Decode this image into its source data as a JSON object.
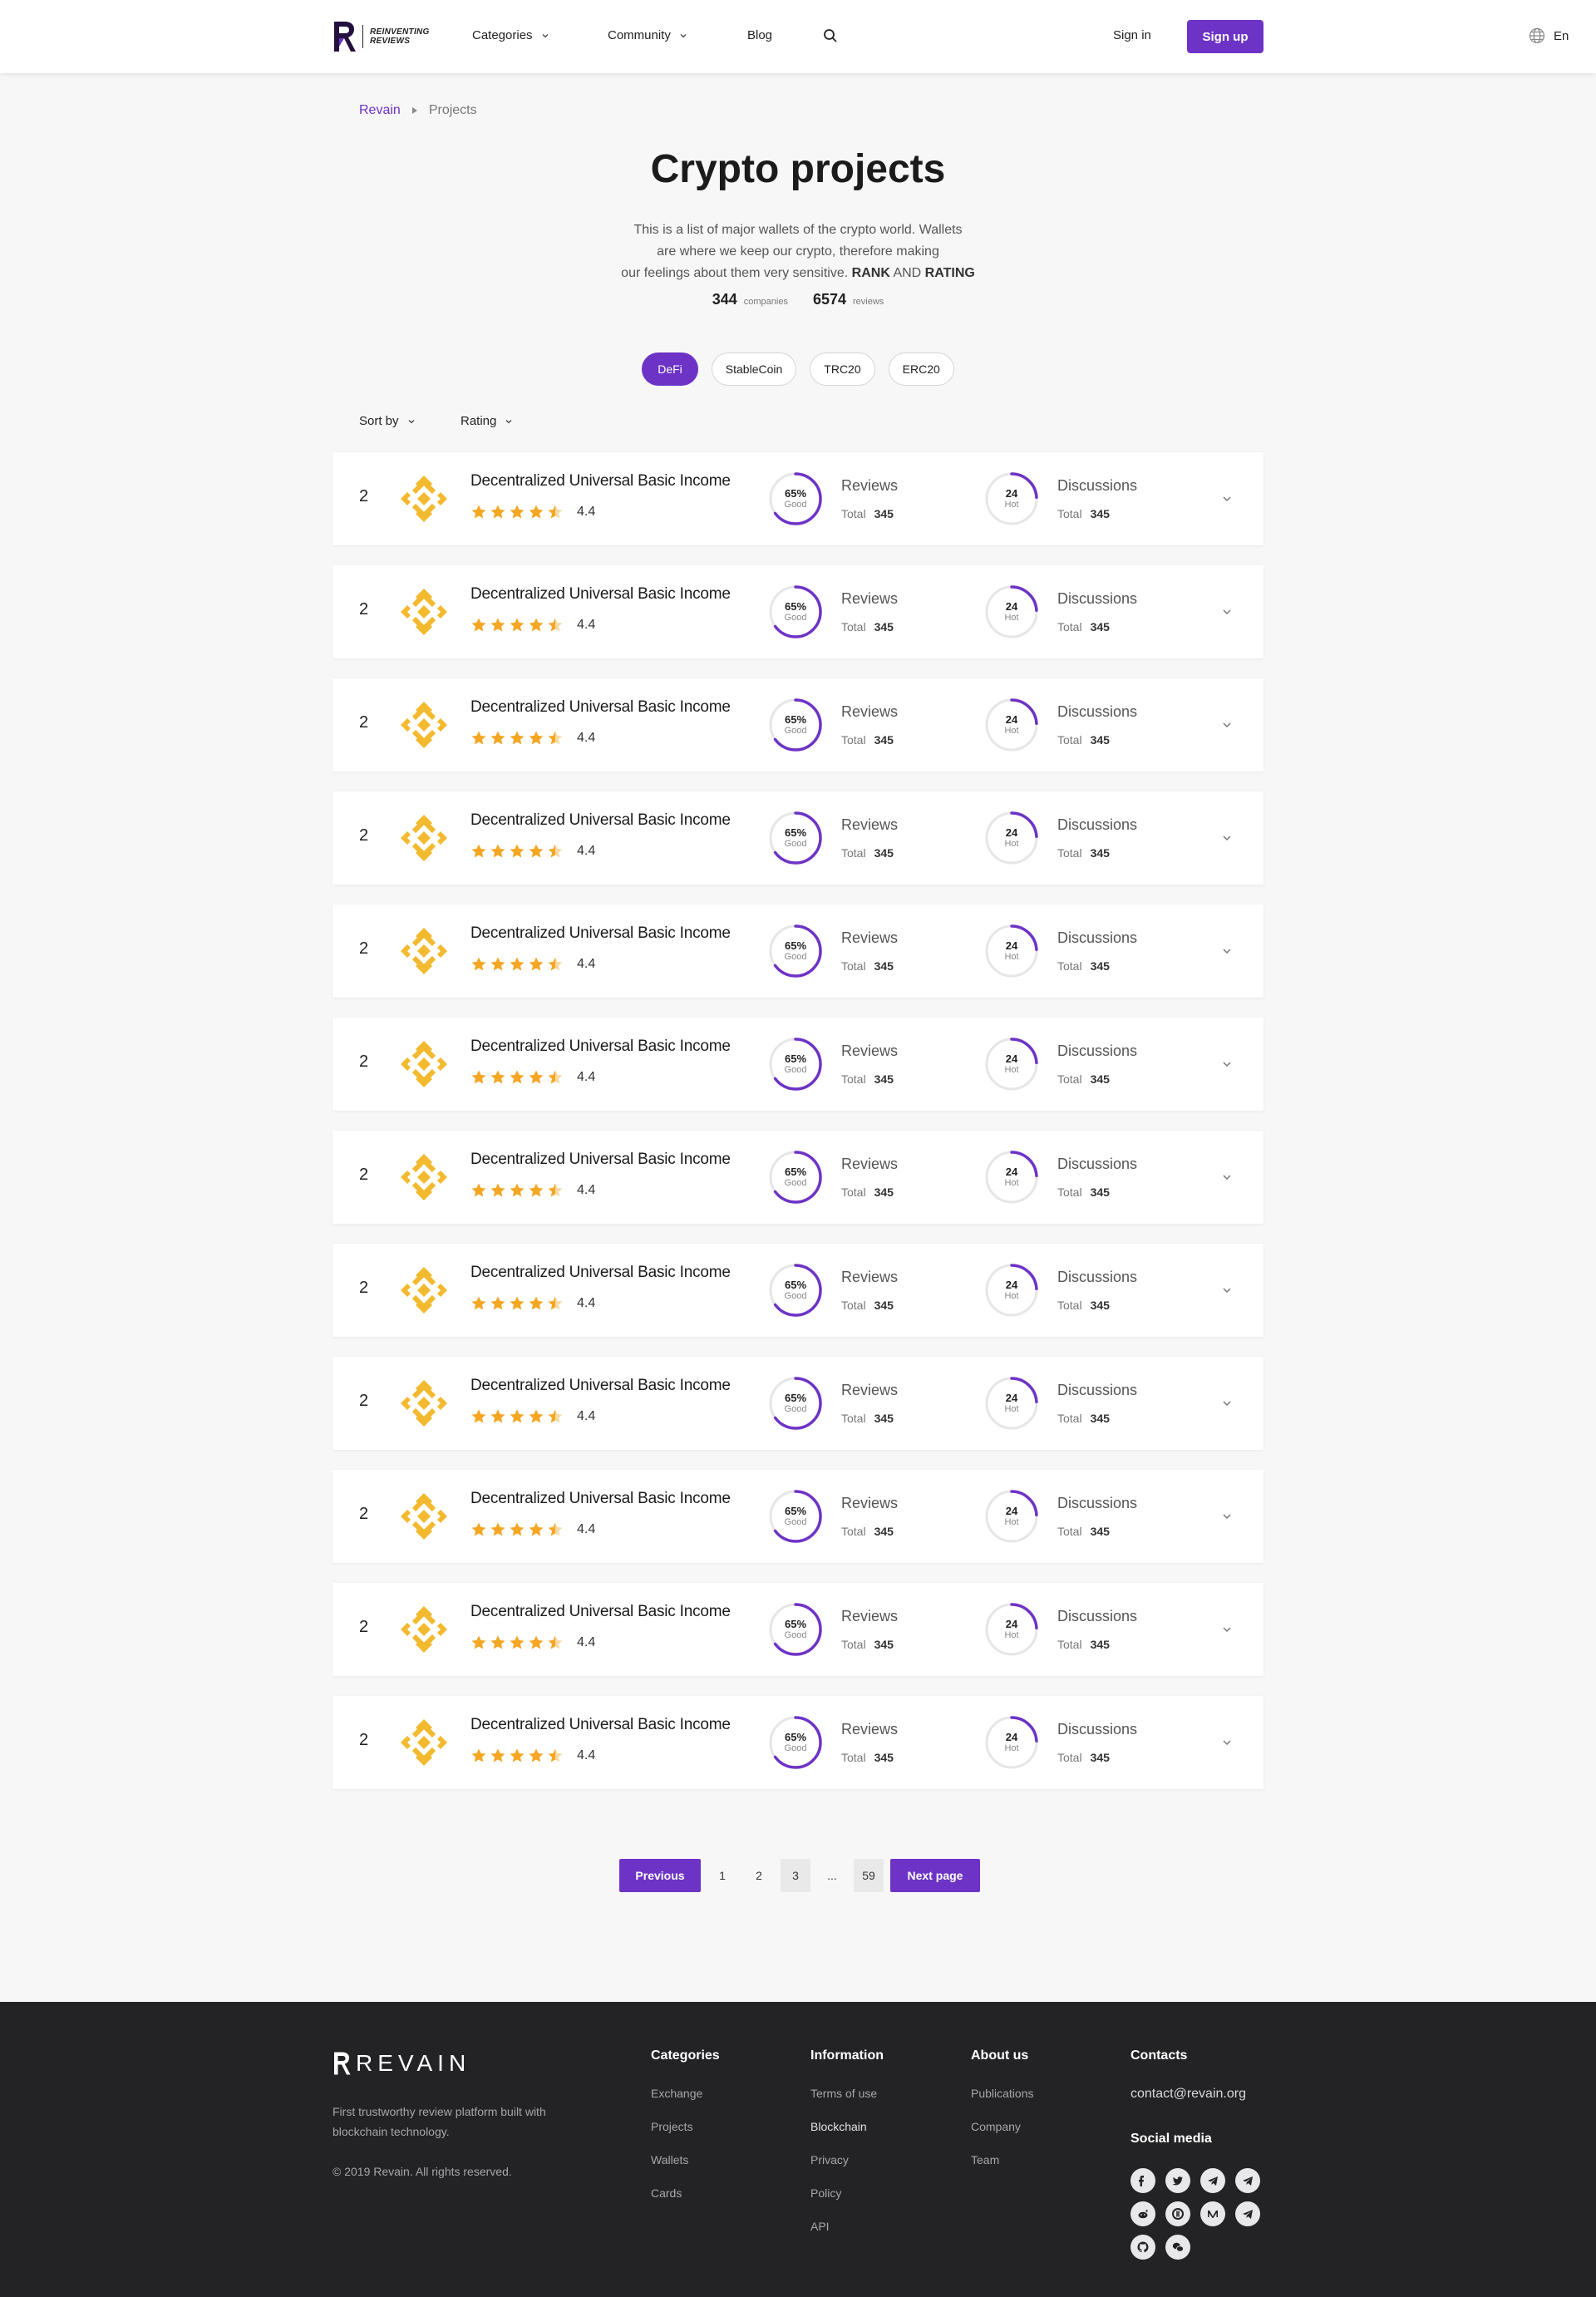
{
  "header": {
    "logo_line1": "REINVENTING",
    "logo_line2": "REVIEWS",
    "nav": {
      "categories": "Categories",
      "community": "Community",
      "blog": "Blog"
    },
    "signin": "Sign in",
    "signup": "Sign up",
    "lang": "En"
  },
  "breadcrumb": {
    "root": "Revain",
    "current": "Projects"
  },
  "hero": {
    "title": "Crypto projects",
    "intro_line1": "This is a list of major wallets of the crypto world. Wallets",
    "intro_line2": "are where we keep our crypto, therefore making",
    "intro_line3": "our feelings about them very sensitive.",
    "intro_rank": "RANK",
    "intro_and": "AND",
    "intro_rating": "RATING",
    "companies_count": "344",
    "companies_label": "companies",
    "reviews_count": "6574",
    "reviews_label": "reviews"
  },
  "tags": [
    "DeFi",
    "StableCoin",
    "TRC20",
    "ERC20"
  ],
  "active_tag": "DeFi",
  "sort": {
    "sort_by": "Sort by",
    "rating": "Rating"
  },
  "projects": [
    {
      "rank": "2",
      "name": "Decentralized Universal Basic Income",
      "rating": "4.4",
      "stars": 4.5,
      "good_pct": "65%",
      "good_label": "Good",
      "good_fraction": 0.65,
      "reviews_title": "Reviews",
      "reviews_total_label": "Total",
      "reviews_total": "345",
      "hot_val": "24",
      "hot_label": "Hot",
      "hot_fraction": 0.24,
      "disc_title": "Discussions",
      "disc_total_label": "Total",
      "disc_total": "345"
    },
    {
      "rank": "2",
      "name": "Decentralized Universal Basic Income",
      "rating": "4.4",
      "stars": 4.5,
      "good_pct": "65%",
      "good_label": "Good",
      "good_fraction": 0.65,
      "reviews_title": "Reviews",
      "reviews_total_label": "Total",
      "reviews_total": "345",
      "hot_val": "24",
      "hot_label": "Hot",
      "hot_fraction": 0.24,
      "disc_title": "Discussions",
      "disc_total_label": "Total",
      "disc_total": "345"
    },
    {
      "rank": "2",
      "name": "Decentralized Universal Basic Income",
      "rating": "4.4",
      "stars": 4.5,
      "good_pct": "65%",
      "good_label": "Good",
      "good_fraction": 0.65,
      "reviews_title": "Reviews",
      "reviews_total_label": "Total",
      "reviews_total": "345",
      "hot_val": "24",
      "hot_label": "Hot",
      "hot_fraction": 0.24,
      "disc_title": "Discussions",
      "disc_total_label": "Total",
      "disc_total": "345"
    },
    {
      "rank": "2",
      "name": "Decentralized Universal Basic Income",
      "rating": "4.4",
      "stars": 4.5,
      "good_pct": "65%",
      "good_label": "Good",
      "good_fraction": 0.65,
      "reviews_title": "Reviews",
      "reviews_total_label": "Total",
      "reviews_total": "345",
      "hot_val": "24",
      "hot_label": "Hot",
      "hot_fraction": 0.24,
      "disc_title": "Discussions",
      "disc_total_label": "Total",
      "disc_total": "345"
    },
    {
      "rank": "2",
      "name": "Decentralized Universal Basic Income",
      "rating": "4.4",
      "stars": 4.5,
      "good_pct": "65%",
      "good_label": "Good",
      "good_fraction": 0.65,
      "reviews_title": "Reviews",
      "reviews_total_label": "Total",
      "reviews_total": "345",
      "hot_val": "24",
      "hot_label": "Hot",
      "hot_fraction": 0.24,
      "disc_title": "Discussions",
      "disc_total_label": "Total",
      "disc_total": "345"
    },
    {
      "rank": "2",
      "name": "Decentralized Universal Basic Income",
      "rating": "4.4",
      "stars": 4.5,
      "good_pct": "65%",
      "good_label": "Good",
      "good_fraction": 0.65,
      "reviews_title": "Reviews",
      "reviews_total_label": "Total",
      "reviews_total": "345",
      "hot_val": "24",
      "hot_label": "Hot",
      "hot_fraction": 0.24,
      "disc_title": "Discussions",
      "disc_total_label": "Total",
      "disc_total": "345"
    },
    {
      "rank": "2",
      "name": "Decentralized Universal Basic Income",
      "rating": "4.4",
      "stars": 4.5,
      "good_pct": "65%",
      "good_label": "Good",
      "good_fraction": 0.65,
      "reviews_title": "Reviews",
      "reviews_total_label": "Total",
      "reviews_total": "345",
      "hot_val": "24",
      "hot_label": "Hot",
      "hot_fraction": 0.24,
      "disc_title": "Discussions",
      "disc_total_label": "Total",
      "disc_total": "345"
    },
    {
      "rank": "2",
      "name": "Decentralized Universal Basic Income",
      "rating": "4.4",
      "stars": 4.5,
      "good_pct": "65%",
      "good_label": "Good",
      "good_fraction": 0.65,
      "reviews_title": "Reviews",
      "reviews_total_label": "Total",
      "reviews_total": "345",
      "hot_val": "24",
      "hot_label": "Hot",
      "hot_fraction": 0.24,
      "disc_title": "Discussions",
      "disc_total_label": "Total",
      "disc_total": "345"
    },
    {
      "rank": "2",
      "name": "Decentralized Universal Basic Income",
      "rating": "4.4",
      "stars": 4.5,
      "good_pct": "65%",
      "good_label": "Good",
      "good_fraction": 0.65,
      "reviews_title": "Reviews",
      "reviews_total_label": "Total",
      "reviews_total": "345",
      "hot_val": "24",
      "hot_label": "Hot",
      "hot_fraction": 0.24,
      "disc_title": "Discussions",
      "disc_total_label": "Total",
      "disc_total": "345"
    },
    {
      "rank": "2",
      "name": "Decentralized Universal Basic Income",
      "rating": "4.4",
      "stars": 4.5,
      "good_pct": "65%",
      "good_label": "Good",
      "good_fraction": 0.65,
      "reviews_title": "Reviews",
      "reviews_total_label": "Total",
      "reviews_total": "345",
      "hot_val": "24",
      "hot_label": "Hot",
      "hot_fraction": 0.24,
      "disc_title": "Discussions",
      "disc_total_label": "Total",
      "disc_total": "345"
    },
    {
      "rank": "2",
      "name": "Decentralized Universal Basic Income",
      "rating": "4.4",
      "stars": 4.5,
      "good_pct": "65%",
      "good_label": "Good",
      "good_fraction": 0.65,
      "reviews_title": "Reviews",
      "reviews_total_label": "Total",
      "reviews_total": "345",
      "hot_val": "24",
      "hot_label": "Hot",
      "hot_fraction": 0.24,
      "disc_title": "Discussions",
      "disc_total_label": "Total",
      "disc_total": "345"
    },
    {
      "rank": "2",
      "name": "Decentralized Universal Basic Income",
      "rating": "4.4",
      "stars": 4.5,
      "good_pct": "65%",
      "good_label": "Good",
      "good_fraction": 0.65,
      "reviews_title": "Reviews",
      "reviews_total_label": "Total",
      "reviews_total": "345",
      "hot_val": "24",
      "hot_label": "Hot",
      "hot_fraction": 0.24,
      "disc_title": "Discussions",
      "disc_total_label": "Total",
      "disc_total": "345"
    }
  ],
  "pagination": {
    "previous": "Previous",
    "pages": [
      "1",
      "2",
      "3",
      "...",
      "59"
    ],
    "shaded_pages": [
      "3",
      "59"
    ],
    "next": "Next page"
  },
  "footer": {
    "brand": "REVAIN",
    "tagline": "First trustworthy review platform built with blockchain technology.",
    "copyright": "© 2019 Revain. All rights reserved.",
    "columns": [
      {
        "title": "Categories",
        "links": [
          "Exchange",
          "Projects",
          "Wallets",
          "Cards"
        ]
      },
      {
        "title": "Information",
        "links": [
          "Terms of use",
          "Blockchain",
          "Privacy",
          "Policy",
          "API"
        ]
      },
      {
        "title": "About us",
        "links": [
          "Publications",
          "Company",
          "Team"
        ]
      }
    ],
    "contacts_title": "Contacts",
    "email": "contact@revain.org",
    "social_title": "Social media",
    "socials": [
      "facebook-icon",
      "twitter-icon",
      "telegram-icon",
      "telegram-icon",
      "reddit-icon",
      "bitcointalk-icon",
      "medium-icon",
      "telegram-icon",
      "github-icon",
      "wechat-icon"
    ]
  },
  "colors": {
    "accent": "#6d33c6",
    "star": "#f5a623",
    "coin": "#f3ba2f",
    "footer_bg": "#232325"
  }
}
